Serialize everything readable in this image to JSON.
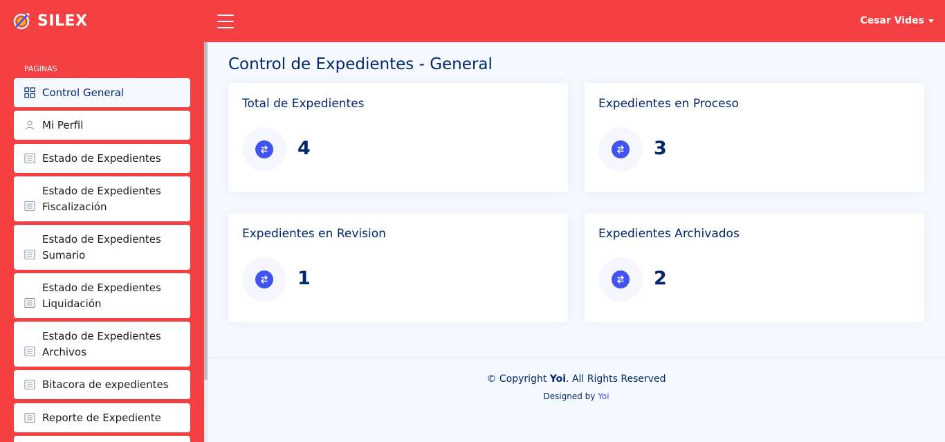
{
  "header": {
    "brand": "SILEX",
    "user_name": "Cesar Vides"
  },
  "sidebar": {
    "heading": "PAGINAS",
    "items": [
      {
        "label": "Control General",
        "icon": "grid-icon"
      },
      {
        "label": "Mi Perfil",
        "icon": "person-icon"
      },
      {
        "label": "Estado de Expedientes",
        "icon": "document-list-icon"
      },
      {
        "label": "Estado de Expedientes Fiscalización",
        "icon": "document-list-icon"
      },
      {
        "label": "Estado de Expedientes Sumario",
        "icon": "document-list-icon"
      },
      {
        "label": "Estado de Expedientes Liquidación",
        "icon": "document-list-icon"
      },
      {
        "label": "Estado de Expedientes Archivos",
        "icon": "document-list-icon"
      },
      {
        "label": "Bitacora de expedientes",
        "icon": "document-list-icon"
      },
      {
        "label": "Reporte de Expediente",
        "icon": "document-list-icon"
      }
    ]
  },
  "main": {
    "title": "Control de Expedientes - General",
    "cards": [
      {
        "title": "Total de Expedientes",
        "value": "4"
      },
      {
        "title": "Expedientes en Proceso",
        "value": "3"
      },
      {
        "title": "Expedientes en Revision",
        "value": "1"
      },
      {
        "title": "Expedientes Archivados",
        "value": "2"
      }
    ]
  },
  "footer": {
    "copyright_prefix": "© Copyright",
    "copyright_brand": "Yoi",
    "copyright_suffix": ". All Rights Reserved",
    "designed_by_prefix": "Designed by",
    "designed_by_link": "Yoi"
  },
  "colors": {
    "header_bg": "#f43f43",
    "sidebar_bg": "#f43f43",
    "page_bg": "#f6f9ff",
    "text_primary": "#012970",
    "accent": "#4154f1"
  }
}
